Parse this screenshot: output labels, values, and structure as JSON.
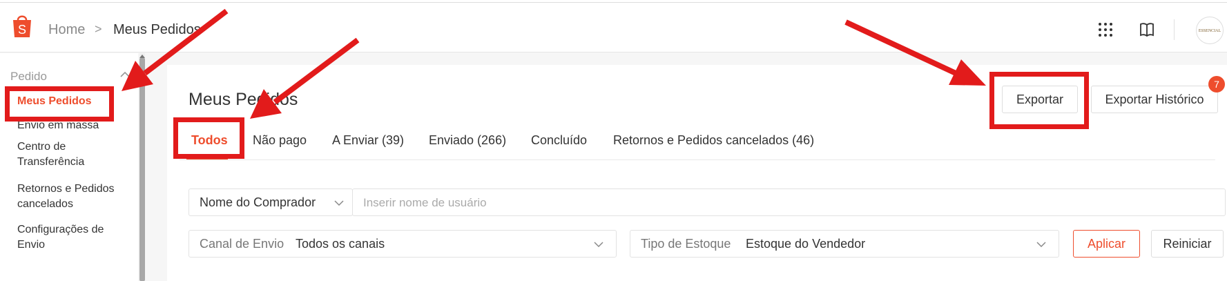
{
  "header": {
    "breadcrumb_home": "Home",
    "breadcrumb_separator": ">",
    "breadcrumb_current": "Meus Pedidos",
    "avatar_text": "ESSENCIAL",
    "brand_color": "#ee4d2d"
  },
  "sidebar": {
    "group_label": "Pedido",
    "items": [
      {
        "label": "Meus Pedidos",
        "active": true
      },
      {
        "label": "Envio em massa"
      },
      {
        "label": "Centro de Transferência"
      },
      {
        "label": "Retornos e Pedidos cancelados"
      },
      {
        "label": "Configurações de Envio"
      }
    ]
  },
  "main": {
    "title": "Meus Pedidos",
    "export_label": "Exportar",
    "export_history_label": "Exportar Histórico",
    "export_history_badge": "7",
    "tabs": [
      {
        "label": "Todos",
        "active": true
      },
      {
        "label": "Não pago"
      },
      {
        "label": "A Enviar (39)"
      },
      {
        "label": "Enviado (266)"
      },
      {
        "label": "Concluído"
      },
      {
        "label": "Retornos e Pedidos cancelados (46)"
      }
    ],
    "search": {
      "field_select": "Nome do Comprador",
      "placeholder": "Inserir nome de usuário"
    },
    "filters": {
      "shipping_label": "Canal de Envio",
      "shipping_value": "Todos os canais",
      "stock_label": "Tipo de Estoque",
      "stock_value": "Estoque do Vendedor",
      "apply_label": "Aplicar",
      "reset_label": "Reiniciar"
    }
  },
  "annotations": {
    "arrow_color": "#e21b1b"
  }
}
